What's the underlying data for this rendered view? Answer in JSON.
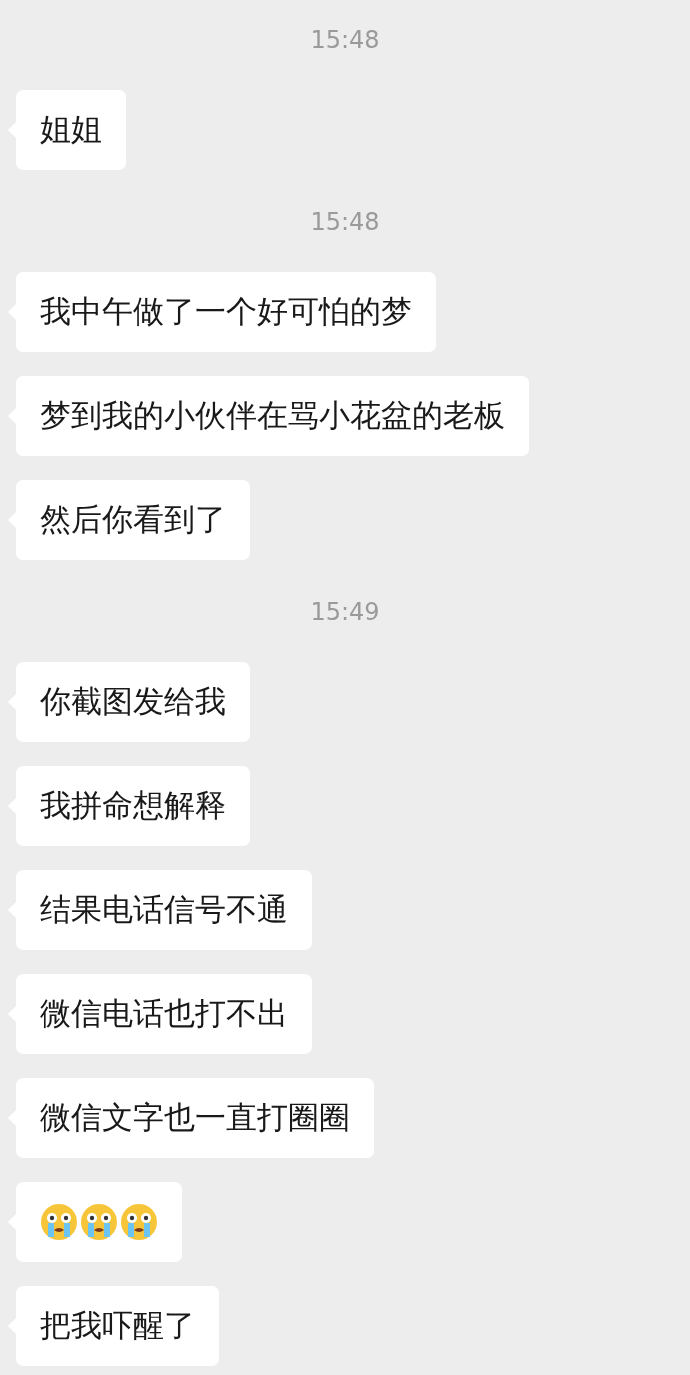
{
  "messages": [
    {
      "kind": "time",
      "text": "15:48"
    },
    {
      "kind": "text",
      "text": "姐姐"
    },
    {
      "kind": "time",
      "text": "15:48"
    },
    {
      "kind": "text",
      "text": "我中午做了一个好可怕的梦"
    },
    {
      "kind": "text",
      "text": "梦到我的小伙伴在骂小花盆的老板"
    },
    {
      "kind": "text",
      "text": "然后你看到了"
    },
    {
      "kind": "time",
      "text": "15:49"
    },
    {
      "kind": "text",
      "text": "你截图发给我"
    },
    {
      "kind": "text",
      "text": "我拼命想解释"
    },
    {
      "kind": "text",
      "text": "结果电话信号不通"
    },
    {
      "kind": "text",
      "text": "微信电话也打不出"
    },
    {
      "kind": "text",
      "text": "微信文字也一直打圈圈"
    },
    {
      "kind": "emoji",
      "icons": [
        {
          "kind": "crying"
        },
        {
          "kind": "crying"
        },
        {
          "kind": "crying"
        }
      ]
    },
    {
      "kind": "text",
      "text": "把我吓醒了"
    }
  ]
}
